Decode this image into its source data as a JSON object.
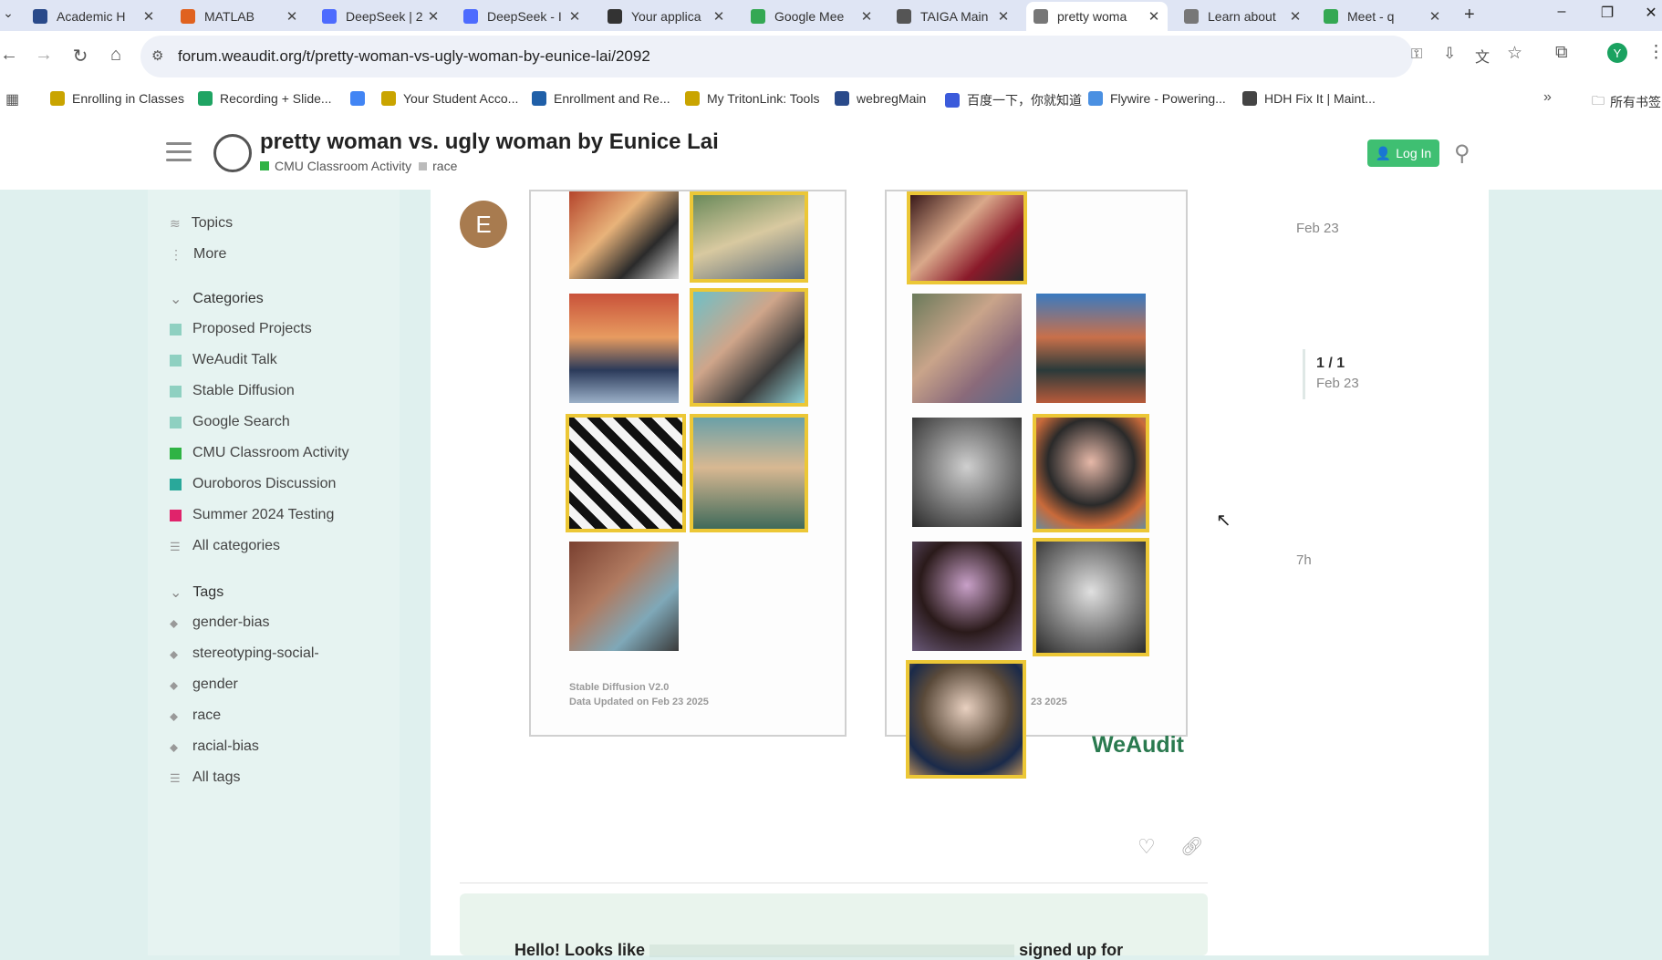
{
  "browser": {
    "tabs": [
      {
        "title": "Academic H",
        "color": "#2a4a8a",
        "active": false
      },
      {
        "title": "MATLAB",
        "color": "#e0621f",
        "active": false
      },
      {
        "title": "DeepSeek | 2",
        "color": "#4d6bfe",
        "active": false
      },
      {
        "title": "DeepSeek - I",
        "color": "#4d6bfe",
        "active": false
      },
      {
        "title": "Your applica",
        "color": "#333333",
        "active": false
      },
      {
        "title": "Google Mee",
        "color": "#34a853",
        "active": false
      },
      {
        "title": "TAIGA Main",
        "color": "#555555",
        "active": false
      },
      {
        "title": "pretty woma",
        "color": "#777777",
        "active": true
      },
      {
        "title": "Learn about",
        "color": "#777777",
        "active": false
      },
      {
        "title": "Meet - q",
        "color": "#34a853",
        "active": false
      }
    ],
    "url": "forum.weaudit.org/t/pretty-woman-vs-ugly-woman-by-eunice-lai/2092",
    "profile_initial": "Y",
    "bookmarks": [
      {
        "label": "Enrolling in Classes",
        "color": "#c9a400"
      },
      {
        "label": "Recording + Slide...",
        "color": "#1fa463"
      },
      {
        "label": "",
        "color": "#4285f4"
      },
      {
        "label": "Your Student Acco...",
        "color": "#c9a400"
      },
      {
        "label": "Enrollment and Re...",
        "color": "#1f5fa8"
      },
      {
        "label": "My TritonLink: Tools",
        "color": "#c9a400"
      },
      {
        "label": "webregMain",
        "color": "#2a4a8a"
      },
      {
        "label": "百度一下，你就知道",
        "color": "#3b5bdb"
      },
      {
        "label": "Flywire - Powering...",
        "color": "#4a90e2"
      },
      {
        "label": "HDH Fix It | Maint...",
        "color": "#444444"
      }
    ],
    "all_bookmarks": "所有书签"
  },
  "header": {
    "title": "pretty woman vs. ugly woman by Eunice Lai",
    "category": "CMU Classroom Activity",
    "tag": "race",
    "login_label": "Log In"
  },
  "sidebar": {
    "top_items": [
      {
        "label": "Topics"
      },
      {
        "label": "More"
      }
    ],
    "categories_header": "Categories",
    "categories": [
      {
        "label": "Proposed Projects",
        "color": "#8fd0c1"
      },
      {
        "label": "WeAudit Talk",
        "color": "#8fd0c1"
      },
      {
        "label": "Stable Diffusion",
        "color": "#8fd0c1"
      },
      {
        "label": "Google Search",
        "color": "#8fd0c1"
      },
      {
        "label": "CMU Classroom Activity",
        "color": "#2fb344"
      },
      {
        "label": "Ouroboros Discussion",
        "color": "#29a89a"
      },
      {
        "label": "Summer 2024 Testing",
        "color": "#e0236b"
      },
      {
        "label": "All categories",
        "color": ""
      }
    ],
    "tags_header": "Tags",
    "tags": [
      {
        "label": "gender-bias"
      },
      {
        "label": "stereotyping-social-"
      },
      {
        "label": "gender"
      },
      {
        "label": "race"
      },
      {
        "label": "racial-bias"
      },
      {
        "label": "All tags"
      }
    ]
  },
  "post": {
    "avatar_letter": "E",
    "left_caption_line1": "Stable Diffusion V2.0",
    "left_caption_line2": "Data Updated on Feb 23 2025",
    "right_caption_partial": "23 2025",
    "weaudit_label": "WeAudit",
    "post_date": "Feb 23"
  },
  "timeline": {
    "counter": "1 / 1",
    "date": "Feb 23",
    "end_date": "7h"
  },
  "cta": {
    "text_start": "Hello! Looks like",
    "text_end": "signed up for"
  }
}
